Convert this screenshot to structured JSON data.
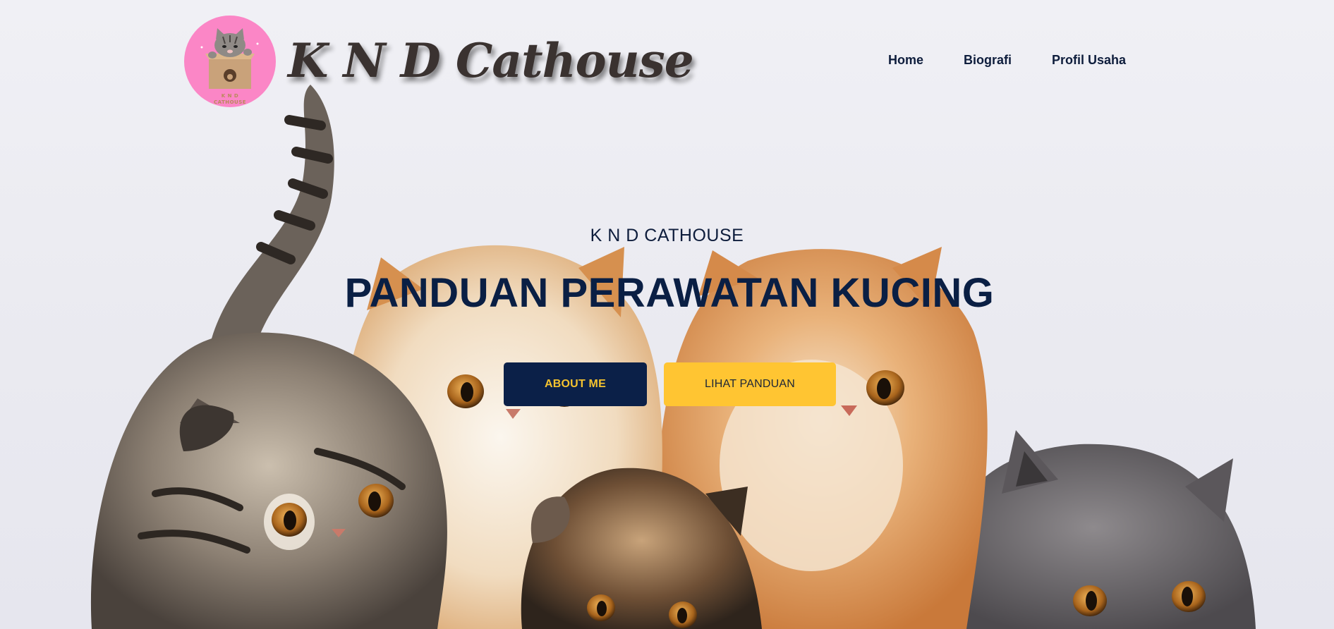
{
  "header": {
    "logo": {
      "name": "knd-cathouse-logo",
      "caption_line1": "K N D",
      "caption_line2": "CATHOUSE"
    },
    "brand_title": "K N D Cathouse",
    "nav": [
      {
        "label": "Home"
      },
      {
        "label": "Biografi"
      },
      {
        "label": "Profil Usaha"
      }
    ]
  },
  "hero": {
    "subtitle": "K N D CATHOUSE",
    "title": "PANDUAN PERAWATAN KUCING",
    "buttons": {
      "about_label": "ABOUT ME",
      "guide_label": "LIHAT PANDUAN"
    },
    "background": "photo of five kittens"
  },
  "colors": {
    "navy": "#0b2048",
    "yellow": "#ffc532",
    "logo_pink": "#fb86c6",
    "background": "#ececf2"
  }
}
